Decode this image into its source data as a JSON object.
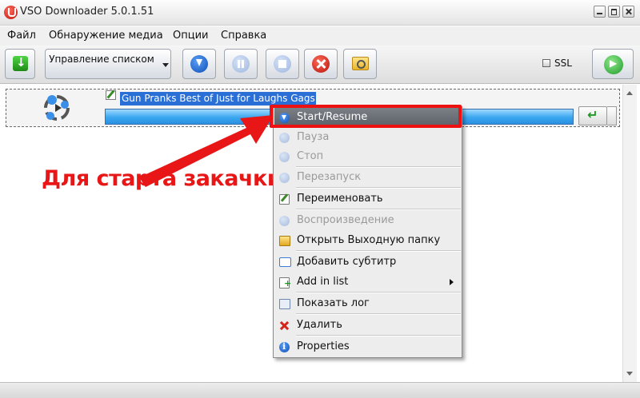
{
  "window": {
    "title": "VSO Downloader 5.0.1.51"
  },
  "menubar": [
    "Файл",
    "Обнаружение медиа",
    "Опции",
    "Справка"
  ],
  "toolbar": {
    "list_management_label": "Управление списком",
    "ssl_label": "SSL"
  },
  "download": {
    "title": "Gun Pranks  Best of Just for Laughs Gags"
  },
  "annotation": "Для старта закачки",
  "context_menu": {
    "items": [
      {
        "label": "Start/Resume",
        "enabled": true,
        "highlighted": true
      },
      {
        "label": "Пауза",
        "enabled": false
      },
      {
        "label": "Стоп",
        "enabled": false
      },
      {
        "label": "Перезапуск",
        "enabled": false
      },
      {
        "label": "Переименовать",
        "enabled": true
      },
      {
        "label": "Воспроизведение",
        "enabled": false
      },
      {
        "label": "Открыть Выходную папку",
        "enabled": true
      },
      {
        "label": "Добавить субтитр",
        "enabled": true
      },
      {
        "label": "Add in list",
        "enabled": true,
        "has_submenu": true
      },
      {
        "label": "Показать лог",
        "enabled": true
      },
      {
        "label": "Удалить",
        "enabled": true
      },
      {
        "label": "Properties",
        "enabled": true
      }
    ]
  },
  "colors": {
    "highlight": "#ee1111",
    "progress": "#3aa7f0",
    "annotation": "#e81616"
  }
}
